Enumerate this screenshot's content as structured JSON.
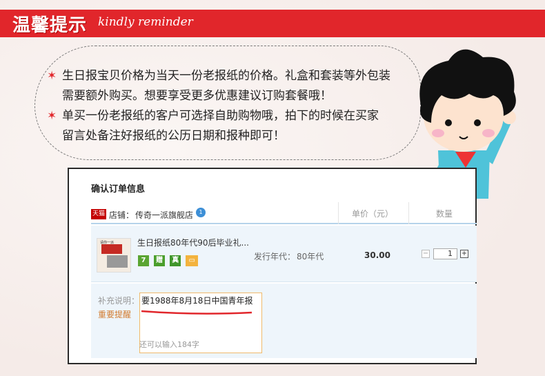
{
  "banner": {
    "title": "温馨提示",
    "subtitle": "kindly reminder"
  },
  "tips": [
    {
      "star": "✶",
      "line1": "生日报宝贝价格为当天一份老报纸的价格。礼盒和套装等外包装",
      "line2": "需要额外购买。想要享受更多优惠建议订购套餐哦！"
    },
    {
      "star": "✶",
      "line1": "单买一份老报纸的客户可选择自助购物哦，拍下的时候在买家",
      "line2": "留言处备注好报纸的公历日期和报种即可！"
    }
  ],
  "order": {
    "title": "确认订单信息",
    "tmall_badge": "天猫",
    "store_label": "店铺：",
    "store_name": "传奇一派旗舰店",
    "ww_icon": "1",
    "col_price": "单价（元）",
    "col_qty": "数量",
    "item": {
      "thumb_text": "请你一派",
      "title": "生日报纸80年代90后毕业礼...",
      "badges": [
        "7",
        "赠",
        "真",
        "▭"
      ],
      "era_label": "发行年代：",
      "era_value": "80年代",
      "price": "30.00",
      "qty": "1",
      "minus": "−",
      "plus": "+"
    },
    "note": {
      "label": "补充说明：",
      "important": "重要提醒",
      "text": "要1988年8月18日中国青年报",
      "remaining": "还可以输入184字"
    }
  },
  "colors": {
    "banner": "#e1262b",
    "accent_orange": "#d27b2f",
    "row_bg": "#eef5fb"
  }
}
